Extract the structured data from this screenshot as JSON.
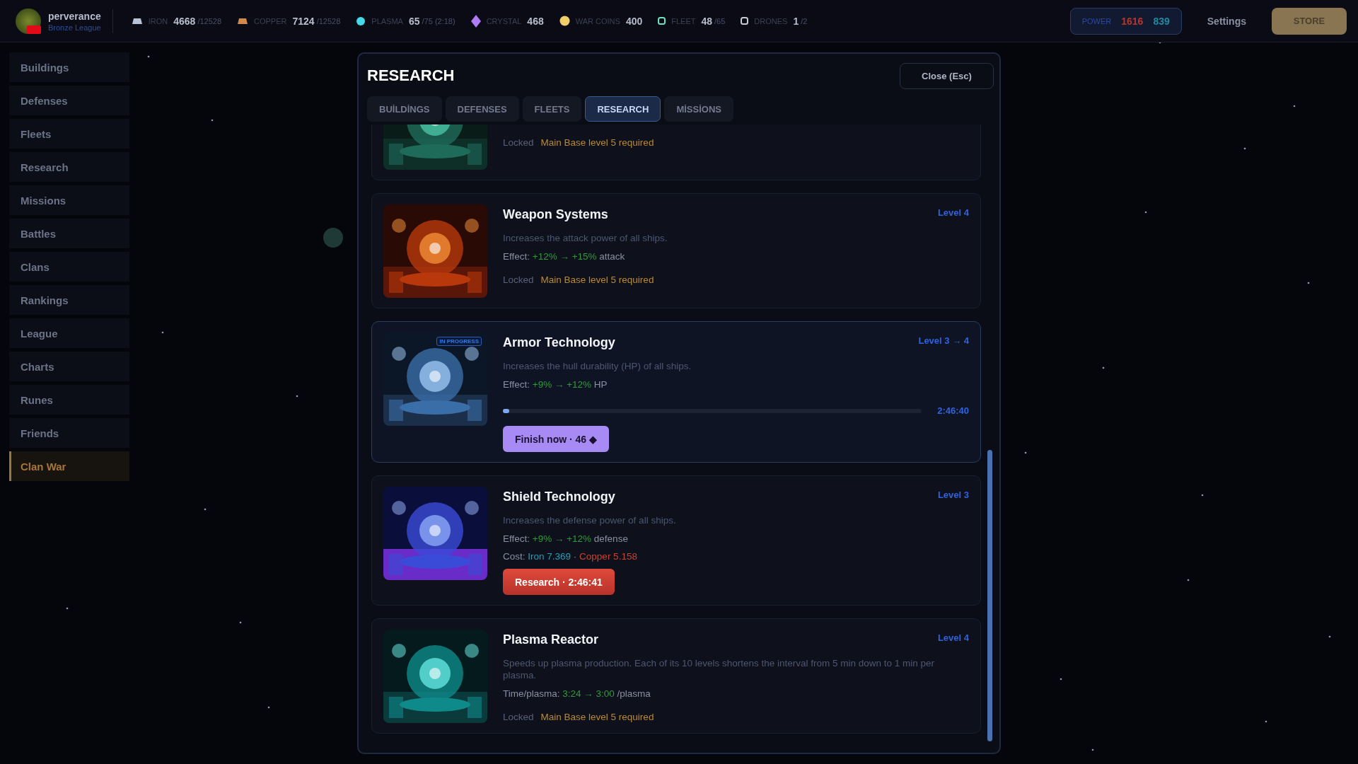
{
  "player": {
    "name": "perverance",
    "league": "Bronze League"
  },
  "resources": [
    {
      "kind": "iron",
      "label": "IRON",
      "value": "4668",
      "cap": "/12528"
    },
    {
      "kind": "copper",
      "label": "COPPER",
      "value": "7124",
      "cap": "/12528"
    },
    {
      "kind": "plasma",
      "label": "PLASMA",
      "value": "65",
      "cap": "/75 (2:18)"
    },
    {
      "kind": "crystal",
      "label": "CRYSTAL",
      "value": "468"
    },
    {
      "kind": "coin",
      "label": "WAR COINS",
      "value": "400"
    },
    {
      "kind": "fleet",
      "label": "FLEET",
      "value": "48",
      "cap": "/65"
    },
    {
      "kind": "drone",
      "label": "DRONES",
      "value": "1",
      "cap": "/2"
    }
  ],
  "power": {
    "label": "POWER",
    "attack": "1616",
    "defense": "839"
  },
  "settings": "Settings",
  "store": "STORE",
  "sidebar": {
    "items": [
      {
        "label": "Buildings",
        "selected": false
      },
      {
        "label": "Defenses",
        "selected": false
      },
      {
        "label": "Fleets",
        "selected": false
      },
      {
        "label": "Research",
        "selected": false
      },
      {
        "label": "Missions",
        "selected": false
      },
      {
        "label": "Battles",
        "selected": false
      },
      {
        "label": "Clans",
        "selected": false
      },
      {
        "label": "Rankings",
        "selected": false
      },
      {
        "label": "League",
        "selected": false
      },
      {
        "label": "Charts",
        "selected": false
      },
      {
        "label": "Runes",
        "selected": false
      },
      {
        "label": "Friends",
        "selected": false
      },
      {
        "label": "Clan War",
        "selected": true
      }
    ]
  },
  "modal": {
    "title": "RESEARCH",
    "close": "Close (Esc)",
    "tabs": [
      {
        "label": "BUİLDİNGS",
        "selected": false
      },
      {
        "label": "DEFENSES",
        "selected": false
      },
      {
        "label": "FLEETS",
        "selected": false
      },
      {
        "label": "RESEARCH",
        "selected": true
      },
      {
        "label": "MİSSİONS",
        "selected": false
      }
    ],
    "cards": [
      {
        "partial": true,
        "status": {
          "kind": "locked",
          "label": "Locked",
          "requirement": "Main Base level 5 required"
        }
      },
      {
        "title": "Weapon Systems",
        "level": "Level 4",
        "description": "Increases the attack power of all ships.",
        "effect": {
          "label": "Effect:",
          "value": "+12% → +15%",
          "unit": "attack"
        },
        "status": {
          "kind": "locked",
          "label": "Locked",
          "requirement": "Main Base level 5 required"
        }
      },
      {
        "title": "Armor Technology",
        "level": "Level 3 → 4",
        "badge": "IN PROGRESS",
        "description": "Increases the hull durability (HP) of all ships.",
        "effect": {
          "label": "Effect:",
          "value": "+9% → +12%",
          "unit": "HP"
        },
        "status": {
          "kind": "progress",
          "level": 0.01,
          "time": "2:46:40",
          "button": "Finish now · 46 ◆"
        }
      },
      {
        "title": "Shield Technology",
        "level": "Level 3",
        "description": "Increases the defense power of all ships.",
        "effect": {
          "label": "Effect:",
          "value": "+9% → +12%",
          "unit": "defense"
        },
        "cost": {
          "label": "Cost:",
          "parts": [
            {
              "kind": "iron",
              "text": "Iron 7.369"
            },
            {
              "kind": "separator",
              "text": "·"
            },
            {
              "kind": "copper",
              "text": "Copper 5.158"
            }
          ]
        },
        "status": {
          "kind": "research",
          "button": "Research · 2:46:41"
        }
      },
      {
        "title": "Plasma Reactor",
        "level": "Level 4",
        "description": "Speeds up plasma production. Each of its 10 levels shortens the interval from 5 min down to 1 min per plasma.",
        "effect": {
          "label": "Time/plasma:",
          "value": "3:24 → 3:00",
          "unit": "/plasma"
        },
        "status": {
          "kind": "locked",
          "label": "Locked",
          "requirement": "Main Base level 5 required"
        }
      }
    ]
  }
}
